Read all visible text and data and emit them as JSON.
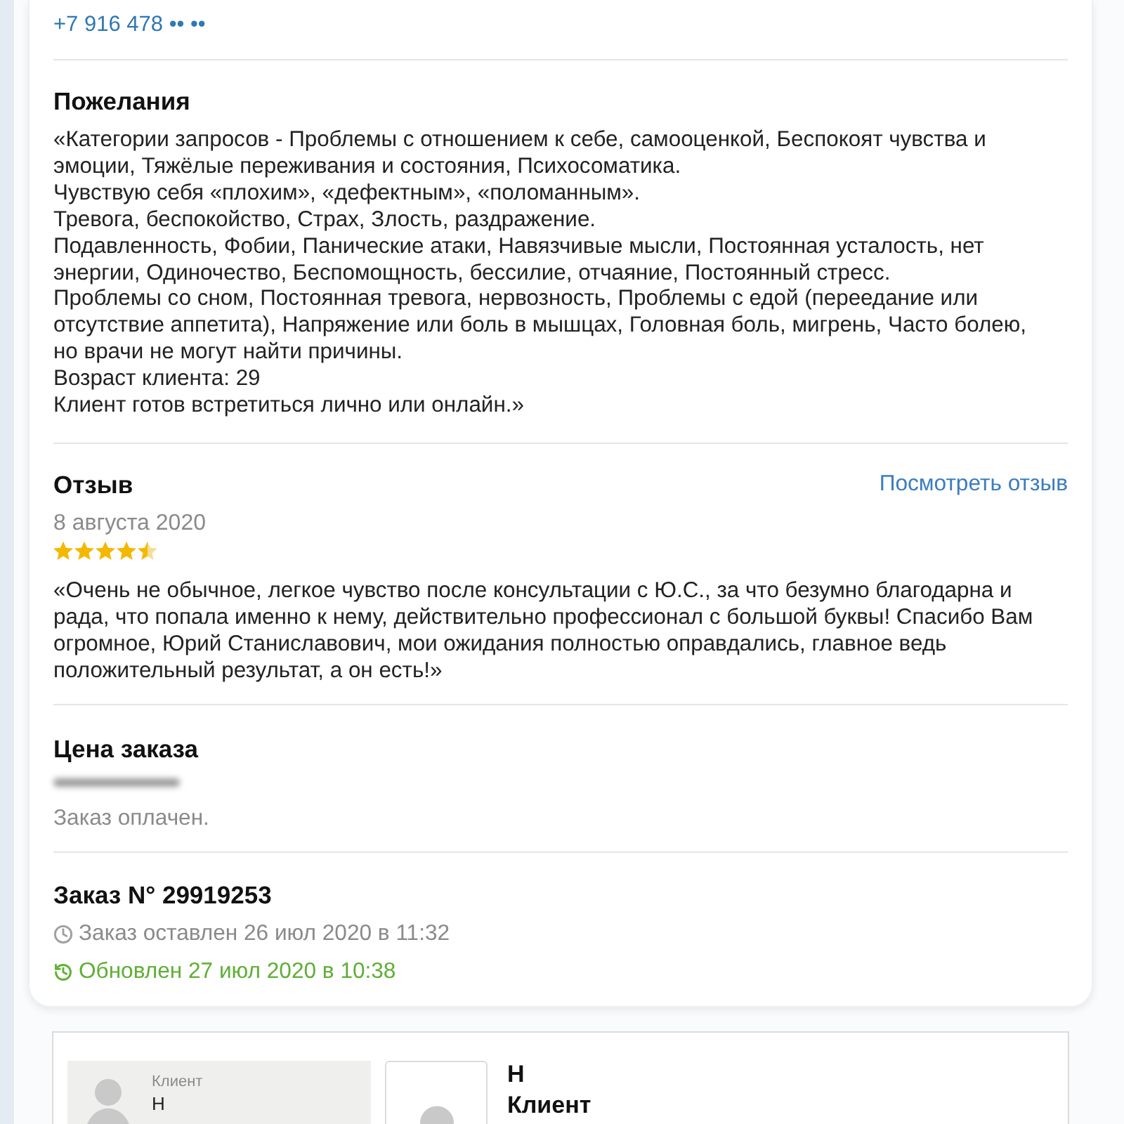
{
  "contact": {
    "phone": "+7 916 478 •• ••"
  },
  "wishes": {
    "title": "Пожелания",
    "text": "«Категории запросов - Проблемы с отношением к себе, самооценкой, Беспокоят чувства и эмоции, Тяжёлые переживания и состояния, Психосоматика.\nЧувствую себя «плохим», «дефектным», «поломанным».\nТревога, беспокойство, Страх, Злость, раздражение.\nПодавленность, Фобии, Панические атаки, Навязчивые мысли, Постоянная усталость, нет энергии, Одиночество, Беспомощность, бессилие, отчаяние, Постоянный стресс.\nПроблемы со сном, Постоянная тревога, нервозность, Проблемы с едой (переедание или отсутствие аппетита), Напряжение или боль в мышцах, Головная боль, мигрень, Часто болею, но врачи не могут найти причины.\nВозраст клиента: 29\nКлиент готов встретиться лично или онлайн.»"
  },
  "review": {
    "title": "Отзыв",
    "link": "Посмотреть отзыв",
    "date": "8 августа 2020",
    "stars": 4.5,
    "text": "«Очень не обычное, легкое чувство после консультации с Ю.С., за что безумно благодарна и рада, что попала именно к нему, действительно профессионал с большой буквы! Спасибо Вам огромное, Юрий Станиславович, мои ожидания полностью оправдались, главное ведь положительный результат, а он есть!»"
  },
  "price": {
    "title": "Цена заказа",
    "status": "Заказ оплачен."
  },
  "order": {
    "title": "Заказ N° 29919253",
    "created": "Заказ оставлен 26 июл 2020 в 11:32",
    "updated": "Обновлен 27 июл 2020 в 10:38"
  },
  "client_card": {
    "preview": {
      "label": "Клиент",
      "name": "Н"
    },
    "name": "Н",
    "role": "Клиент"
  }
}
